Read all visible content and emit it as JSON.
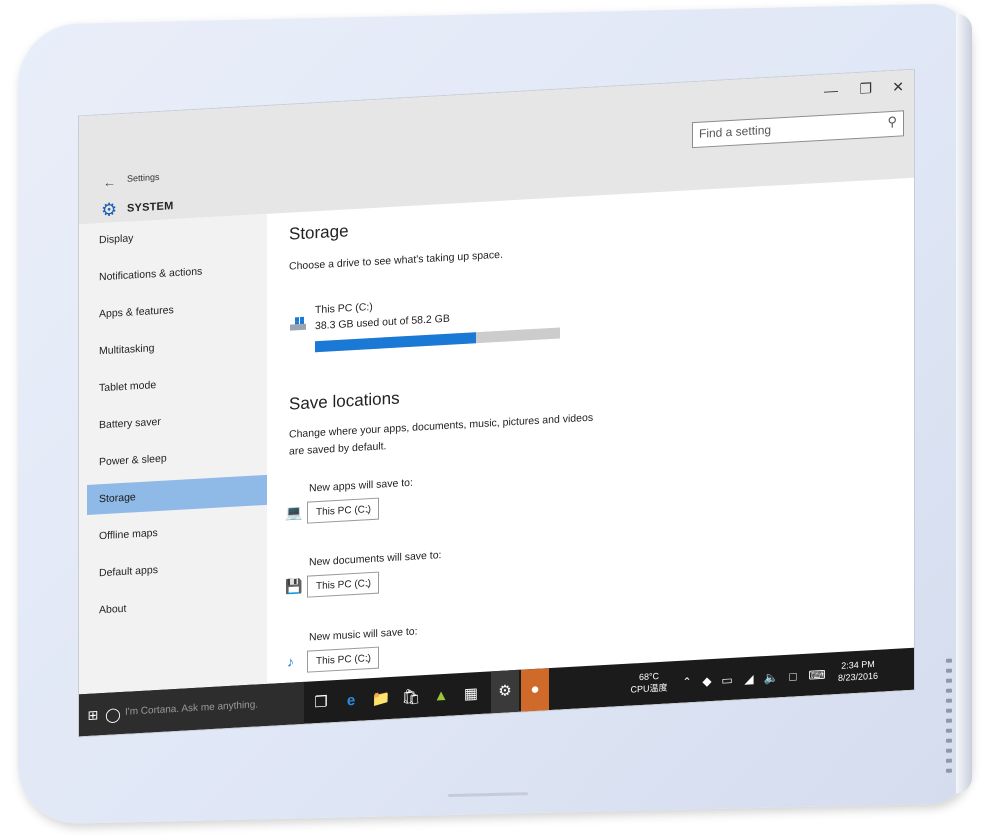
{
  "window": {
    "app_title": "Settings",
    "section_title": "SYSTEM",
    "search_placeholder": "Find a setting"
  },
  "sidebar": {
    "items": [
      {
        "label": "Display"
      },
      {
        "label": "Notifications & actions"
      },
      {
        "label": "Apps & features"
      },
      {
        "label": "Multitasking"
      },
      {
        "label": "Tablet mode"
      },
      {
        "label": "Battery saver"
      },
      {
        "label": "Power & sleep"
      },
      {
        "label": "Storage",
        "active": true
      },
      {
        "label": "Offline maps"
      },
      {
        "label": "Default apps"
      },
      {
        "label": "About"
      }
    ]
  },
  "storage": {
    "heading": "Storage",
    "description": "Choose a drive to see what's taking up space.",
    "drive": {
      "name": "This PC (C:)",
      "usage_text": "38.3 GB used out of 58.2 GB",
      "used_fraction": 0.658
    }
  },
  "save_locations": {
    "heading": "Save locations",
    "description_line1": "Change where your apps, documents, music, pictures and videos",
    "description_line2": "are saved by default.",
    "items": [
      {
        "label": "New apps will save to:",
        "value": "This PC (C:)",
        "icon": "monitor-icon"
      },
      {
        "label": "New documents will save to:",
        "value": "This PC (C:)",
        "icon": "document-drive-icon"
      },
      {
        "label": "New music will save to:",
        "value": "This PC (C:)",
        "icon": "music-note-icon"
      }
    ]
  },
  "taskbar": {
    "cortana_text": "I'm Cortana. Ask me anything.",
    "temperature": "68°C",
    "cpu_label": "CPU温度",
    "time": "2:34 PM",
    "date": "8/23/2016"
  },
  "colors": {
    "accent": "#1a79d4",
    "active_nav": "#8fb9e7",
    "taskbar": "#1b1b1b"
  }
}
